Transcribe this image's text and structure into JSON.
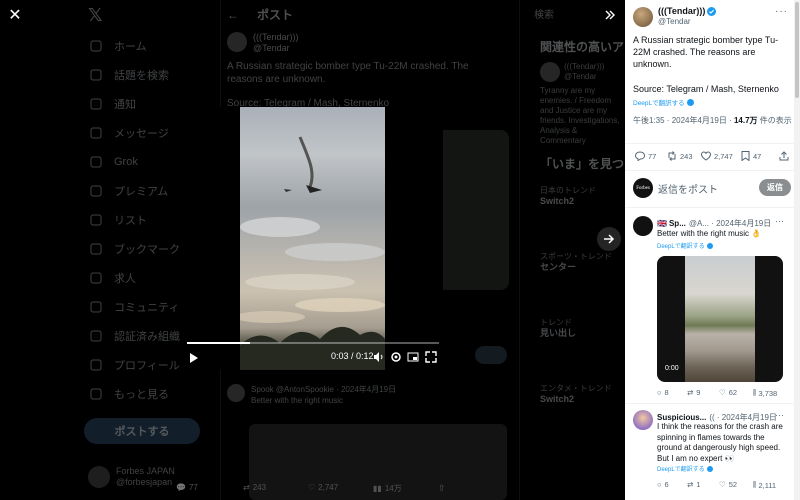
{
  "background": {
    "nav_items": [
      {
        "label": "ホーム",
        "icon": "home-icon"
      },
      {
        "label": "話題を検索",
        "icon": "search-icon"
      },
      {
        "label": "通知",
        "icon": "bell-icon"
      },
      {
        "label": "メッセージ",
        "icon": "mail-icon"
      },
      {
        "label": "Grok",
        "icon": "grok-icon"
      },
      {
        "label": "プレミアム",
        "icon": "x-premium-icon"
      },
      {
        "label": "リスト",
        "icon": "list-icon"
      },
      {
        "label": "ブックマーク",
        "icon": "bookmark-icon"
      },
      {
        "label": "求人",
        "icon": "briefcase-icon"
      },
      {
        "label": "コミュニティ",
        "icon": "community-icon"
      },
      {
        "label": "認証済み組織",
        "icon": "lightning-icon"
      },
      {
        "label": "プロフィール",
        "icon": "person-icon"
      },
      {
        "label": "もっと見る",
        "icon": "more-circle-icon"
      }
    ],
    "post_button": "ポストする",
    "profile_name": "Forbes JAPAN",
    "profile_handle": "@forbesjapan",
    "center_title": "ポスト",
    "center_author": "(((Tendar)))",
    "center_handle": "@Tendar",
    "center_text": "A Russian strategic bomber type Tu-22M crashed. The reasons are unknown.",
    "center_source": "Source: Telegram / Mash, Sternenko",
    "second_author": "Spook",
    "second_handle": "@AntonSpookie",
    "second_date": "2024年4月19日",
    "second_text": "Better with the right music",
    "bottom_stats": {
      "replies": "77",
      "reposts": "243",
      "likes": "2,747",
      "views": "14万"
    },
    "right_search": "検索",
    "right_title": "関連性の高いアカウント",
    "right_card_name": "(((Tendar)))",
    "right_card_handle": "@Tendar",
    "right_card_bio": "Tyranny are my enemies. / Freedom and Justice are my friends. Investigations, Analysis & Commentary",
    "right_title2": "「いま」を見つけよう",
    "right_trends": [
      {
        "meta": "日本のトレンド",
        "name": "Switch2"
      },
      {
        "meta": "スポーツ・トレンド",
        "name": "センター"
      },
      {
        "meta": "トレンド",
        "name": "見い出し"
      },
      {
        "meta": "エンタメ・トレンド",
        "name": "Switch2"
      }
    ]
  },
  "video": {
    "current_time": "0:03",
    "duration": "0:12",
    "time_display": "0:03 / 0:12",
    "progress": 0.25
  },
  "panel": {
    "author_name": "(((Tendar)))",
    "author_handle": "@Tendar",
    "text": "A Russian strategic bomber type Tu-22M crashed. The reasons are unknown.",
    "source": "Source: Telegram / Mash, Sternenko",
    "translate": "DeepLで翻訳する",
    "time": "午後1:35",
    "date": "2024年4月19日",
    "views_count": "14.7万",
    "views_label": "件の表示",
    "stats": {
      "replies": "77",
      "reposts": "243",
      "likes": "2,747",
      "bookmarks": "47"
    },
    "reply_placeholder": "返信をポスト",
    "reply_button": "返信",
    "reply_avatar_text": "Forbes"
  },
  "replies": [
    {
      "name": "Sp...",
      "handle": "@A...",
      "date": "2024年4月19日",
      "text": "Better with the right music 👌",
      "translate": "DeepLで翻訳する",
      "video_duration": "0:00",
      "stats": {
        "replies": "8",
        "reposts": "9",
        "likes": "62",
        "views": "3,738"
      }
    },
    {
      "name": "Suspicious...",
      "handle": "(( ",
      "date": "2024年4月19日",
      "text": "I think the reasons for the crash are spinning in flames towards the ground at dangerously high speed. But I am no expert 👀",
      "translate": "DeepLで翻訳する",
      "stats": {
        "replies": "6",
        "reposts": "1",
        "likes": "52",
        "views": "2,111"
      }
    }
  ],
  "colors": {
    "accent": "#1d9bf0",
    "panel_bg": "#ffffff",
    "overlay_bg": "#000000"
  }
}
